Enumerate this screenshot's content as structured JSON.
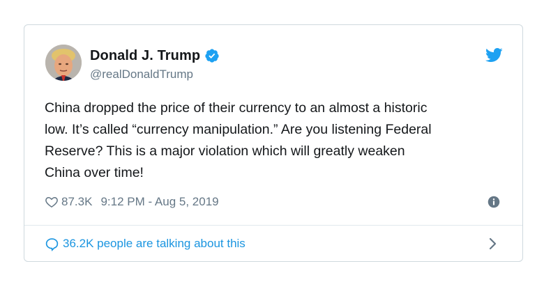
{
  "user": {
    "display_name": "Donald J. Trump",
    "handle": "@realDonaldTrump",
    "verified": true
  },
  "tweet": {
    "text": "China dropped the price of their currency to an almost a historic\nlow. It’s called “currency manipulation.” Are you listening Federal\nReserve? This is a major violation which will greatly weaken\nChina over time!",
    "likes": "87.3K",
    "timestamp": "9:12 PM - Aug 5, 2019"
  },
  "footer": {
    "talking_text": "36.2K people are talking about this"
  },
  "icons": {
    "verified": "verified-badge-icon",
    "brand": "twitter-bird-icon",
    "like": "heart-icon",
    "info": "info-icon",
    "reply": "speech-bubble-icon",
    "chevron": "chevron-right-icon"
  },
  "colors": {
    "twitter_blue": "#1da1f2",
    "link_blue": "#1b95e0",
    "text": "#14171a",
    "muted": "#657786",
    "border": "#cfd9de"
  }
}
